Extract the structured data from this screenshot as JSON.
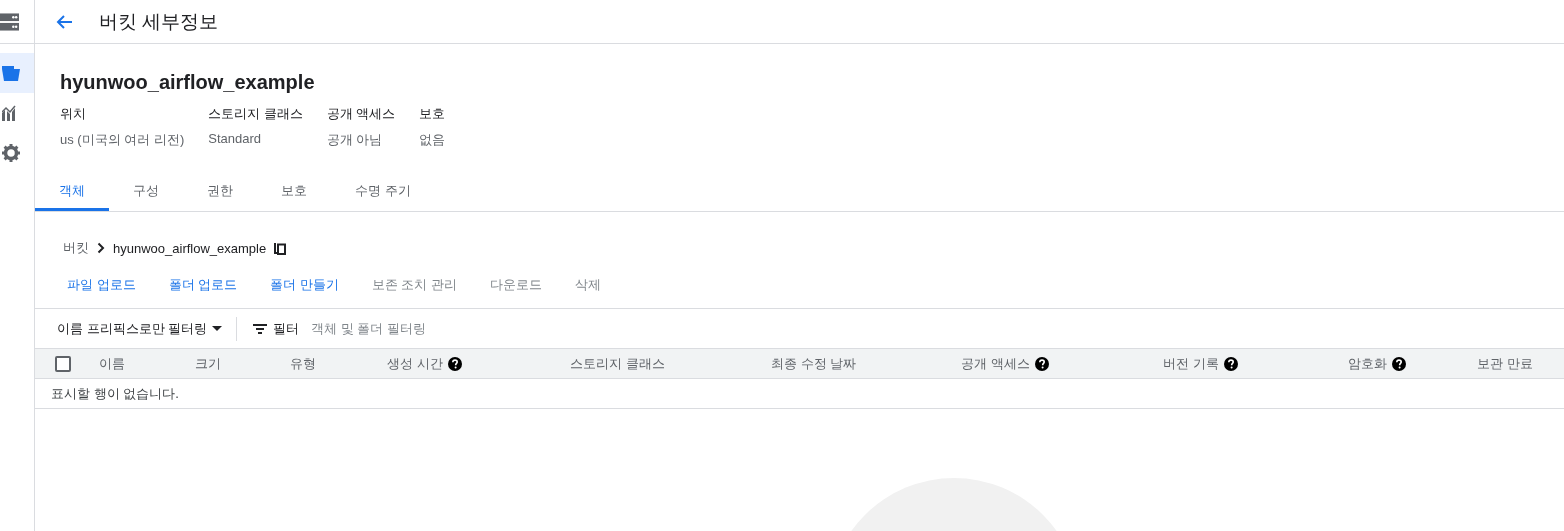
{
  "sidebar": {
    "items": [
      {
        "selected": false
      },
      {
        "selected": true
      },
      {
        "selected": false
      },
      {
        "selected": false
      }
    ]
  },
  "header": {
    "title": "버킷 세부정보"
  },
  "bucket": {
    "name": "hyunwoo_airflow_example",
    "properties": [
      {
        "label": "위치",
        "value": "us (미국의 여러 리전)"
      },
      {
        "label": "스토리지 클래스",
        "value": "Standard"
      },
      {
        "label": "공개 액세스",
        "value": "공개 아님"
      },
      {
        "label": "보호",
        "value": "없음"
      }
    ]
  },
  "tabs": [
    {
      "label": "객체",
      "selected": true
    },
    {
      "label": "구성",
      "selected": false
    },
    {
      "label": "권한",
      "selected": false
    },
    {
      "label": "보호",
      "selected": false
    },
    {
      "label": "수명 주기",
      "selected": false
    }
  ],
  "breadcrumb": {
    "root": "버킷",
    "current": "hyunwoo_airflow_example"
  },
  "actions": [
    {
      "label": "파일 업로드",
      "disabled": false
    },
    {
      "label": "폴더 업로드",
      "disabled": false
    },
    {
      "label": "폴더 만들기",
      "disabled": false
    },
    {
      "label": "보존 조치 관리",
      "disabled": true
    },
    {
      "label": "다운로드",
      "disabled": true
    },
    {
      "label": "삭제",
      "disabled": true
    }
  ],
  "filter": {
    "mode": "이름 프리픽스로만 필터링",
    "label": "필터",
    "placeholder": "객체 및 폴더 필터링"
  },
  "table": {
    "select_all": {
      "checked": false
    },
    "columns": [
      {
        "label": "이름",
        "help": false
      },
      {
        "label": "크기",
        "help": false
      },
      {
        "label": "유형",
        "help": false
      },
      {
        "label": "생성 시간",
        "help": true
      },
      {
        "label": "스토리지 클래스",
        "help": false
      },
      {
        "label": "최종 수정 날짜",
        "help": false
      },
      {
        "label": "공개 액세스",
        "help": true
      },
      {
        "label": "버전 기록",
        "help": true
      },
      {
        "label": "암호화",
        "help": true
      },
      {
        "label": "보관 만료",
        "help": false
      }
    ],
    "empty_message": "표시할 행이 없습니다."
  }
}
